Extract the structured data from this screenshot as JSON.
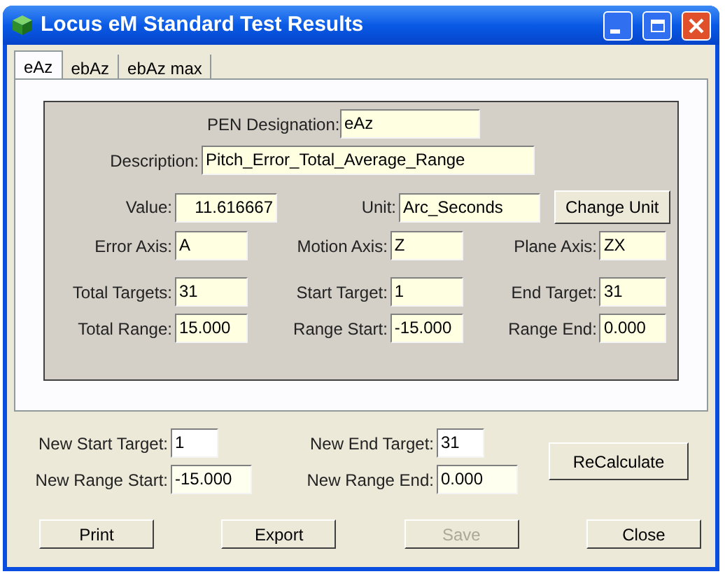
{
  "window": {
    "title": "Locus eM Standard Test Results"
  },
  "tabs": [
    {
      "label": "eAz",
      "selected": true
    },
    {
      "label": "ebAz",
      "selected": false
    },
    {
      "label": "ebAz max",
      "selected": false
    }
  ],
  "results": {
    "pen": {
      "label": "PEN Designation:",
      "value": "eAz"
    },
    "description": {
      "label": "Description:",
      "value": "Pitch_Error_Total_Average_Range"
    },
    "value": {
      "label": "Value:",
      "value": "11.616667"
    },
    "unit": {
      "label": "Unit:",
      "value": "Arc_Seconds"
    },
    "change_unit_button": "Change Unit",
    "rows": [
      [
        {
          "label": "Error Axis:",
          "value": "A"
        },
        {
          "label": "Motion Axis:",
          "value": "Z"
        },
        {
          "label": "Plane Axis:",
          "value": "ZX"
        }
      ],
      [
        {
          "label": "Total Targets:",
          "value": "31"
        },
        {
          "label": "Start Target:",
          "value": "1"
        },
        {
          "label": "End Target:",
          "value": "31"
        }
      ],
      [
        {
          "label": "Total Range:",
          "value": "15.000"
        },
        {
          "label": "Range Start:",
          "value": "-15.000"
        },
        {
          "label": "Range End:",
          "value": "0.000"
        }
      ]
    ]
  },
  "recalc": {
    "fields": [
      [
        {
          "label": "New Start Target:",
          "value": "1"
        },
        {
          "label": "New End Target:",
          "value": "31"
        }
      ],
      [
        {
          "label": "New Range Start:",
          "value": "-15.000"
        },
        {
          "label": "New Range End:",
          "value": "0.000"
        }
      ]
    ],
    "button": "ReCalculate"
  },
  "buttons": [
    {
      "label": "Print",
      "disabled": false
    },
    {
      "label": "Export",
      "disabled": false
    },
    {
      "label": "Save",
      "disabled": true
    },
    {
      "label": "Close",
      "disabled": false
    }
  ]
}
